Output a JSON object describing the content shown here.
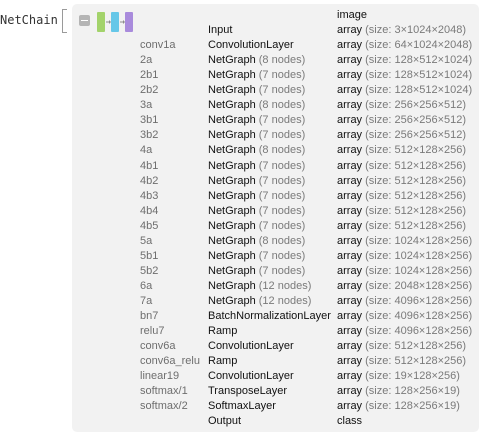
{
  "expression_label": "NetChain",
  "colors": {
    "panel": "#f2f2f2",
    "toggle": "#b5b5b5",
    "icon_green": "#a3d36b",
    "icon_blue": "#66c7e8",
    "icon_purple": "#a98bdc"
  },
  "icons": [
    "collapse-toggle-icon",
    "network-chain-icon"
  ],
  "header": {
    "port_name": "image"
  },
  "rows": [
    {
      "name": "",
      "type": "Input",
      "type_note": "",
      "port_main": "array",
      "port_size": "(size: 3×1024×2048)"
    },
    {
      "name": "conv1a",
      "type": "ConvolutionLayer",
      "type_note": "",
      "port_main": "array",
      "port_size": "(size: 64×1024×2048)"
    },
    {
      "name": "2a",
      "type": "NetGraph",
      "type_note": "(8 nodes)",
      "port_main": "array",
      "port_size": "(size: 128×512×1024)"
    },
    {
      "name": "2b1",
      "type": "NetGraph",
      "type_note": "(7 nodes)",
      "port_main": "array",
      "port_size": "(size: 128×512×1024)"
    },
    {
      "name": "2b2",
      "type": "NetGraph",
      "type_note": "(7 nodes)",
      "port_main": "array",
      "port_size": "(size: 128×512×1024)"
    },
    {
      "name": "3a",
      "type": "NetGraph",
      "type_note": "(8 nodes)",
      "port_main": "array",
      "port_size": "(size: 256×256×512)"
    },
    {
      "name": "3b1",
      "type": "NetGraph",
      "type_note": "(7 nodes)",
      "port_main": "array",
      "port_size": "(size: 256×256×512)"
    },
    {
      "name": "3b2",
      "type": "NetGraph",
      "type_note": "(7 nodes)",
      "port_main": "array",
      "port_size": "(size: 256×256×512)"
    },
    {
      "name": "4a",
      "type": "NetGraph",
      "type_note": "(8 nodes)",
      "port_main": "array",
      "port_size": "(size: 512×128×256)"
    },
    {
      "name": "4b1",
      "type": "NetGraph",
      "type_note": "(7 nodes)",
      "port_main": "array",
      "port_size": "(size: 512×128×256)"
    },
    {
      "name": "4b2",
      "type": "NetGraph",
      "type_note": "(7 nodes)",
      "port_main": "array",
      "port_size": "(size: 512×128×256)"
    },
    {
      "name": "4b3",
      "type": "NetGraph",
      "type_note": "(7 nodes)",
      "port_main": "array",
      "port_size": "(size: 512×128×256)"
    },
    {
      "name": "4b4",
      "type": "NetGraph",
      "type_note": "(7 nodes)",
      "port_main": "array",
      "port_size": "(size: 512×128×256)"
    },
    {
      "name": "4b5",
      "type": "NetGraph",
      "type_note": "(7 nodes)",
      "port_main": "array",
      "port_size": "(size: 512×128×256)"
    },
    {
      "name": "5a",
      "type": "NetGraph",
      "type_note": "(8 nodes)",
      "port_main": "array",
      "port_size": "(size: 1024×128×256)"
    },
    {
      "name": "5b1",
      "type": "NetGraph",
      "type_note": "(7 nodes)",
      "port_main": "array",
      "port_size": "(size: 1024×128×256)"
    },
    {
      "name": "5b2",
      "type": "NetGraph",
      "type_note": "(7 nodes)",
      "port_main": "array",
      "port_size": "(size: 1024×128×256)"
    },
    {
      "name": "6a",
      "type": "NetGraph",
      "type_note": "(12 nodes)",
      "port_main": "array",
      "port_size": "(size: 2048×128×256)"
    },
    {
      "name": "7a",
      "type": "NetGraph",
      "type_note": "(12 nodes)",
      "port_main": "array",
      "port_size": "(size: 4096×128×256)"
    },
    {
      "name": "bn7",
      "type": "BatchNormalizationLayer",
      "type_note": "",
      "port_main": "array",
      "port_size": "(size: 4096×128×256)"
    },
    {
      "name": "relu7",
      "type": "Ramp",
      "type_note": "",
      "port_main": "array",
      "port_size": "(size: 4096×128×256)"
    },
    {
      "name": "conv6a",
      "type": "ConvolutionLayer",
      "type_note": "",
      "port_main": "array",
      "port_size": "(size: 512×128×256)"
    },
    {
      "name": "conv6a_relu",
      "type": "Ramp",
      "type_note": "",
      "port_main": "array",
      "port_size": "(size: 512×128×256)"
    },
    {
      "name": "linear19",
      "type": "ConvolutionLayer",
      "type_note": "",
      "port_main": "array",
      "port_size": "(size: 19×128×256)"
    },
    {
      "name": "softmax/1",
      "type": "TransposeLayer",
      "type_note": "",
      "port_main": "array",
      "port_size": "(size: 128×256×19)"
    },
    {
      "name": "softmax/2",
      "type": "SoftmaxLayer",
      "type_note": "",
      "port_main": "array",
      "port_size": "(size: 128×256×19)"
    },
    {
      "name": "",
      "type": "Output",
      "type_note": "",
      "port_main": "class",
      "port_size": ""
    }
  ]
}
